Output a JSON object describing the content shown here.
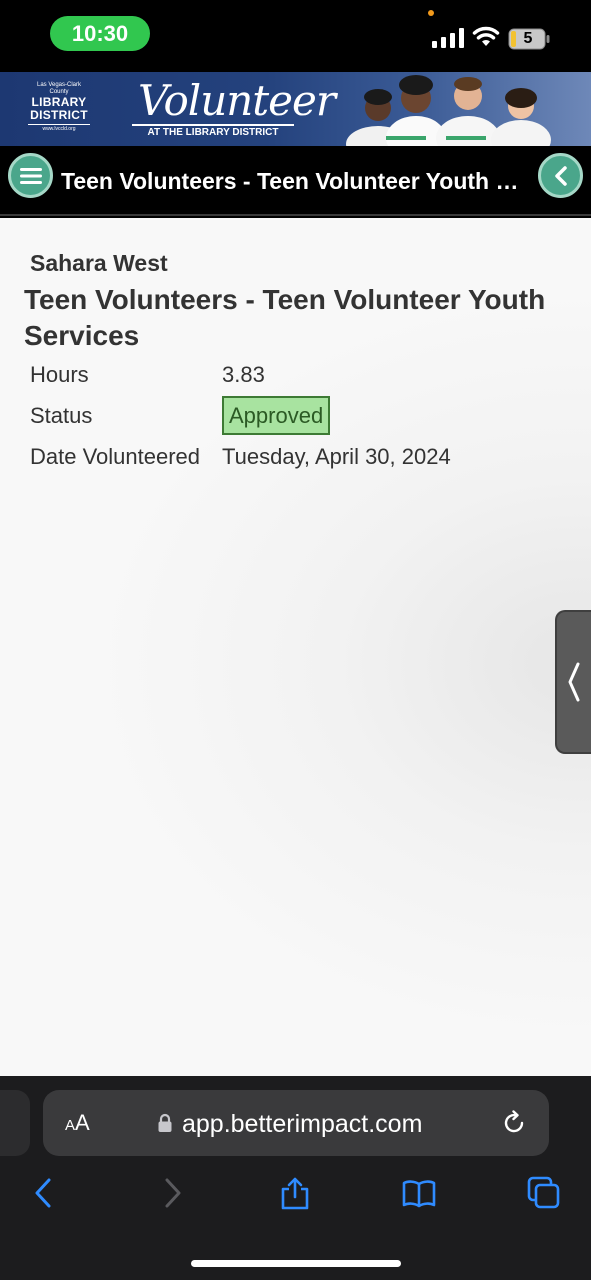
{
  "status_bar": {
    "time": "10:30",
    "battery": "5",
    "icons": [
      "signal-icon",
      "wifi-icon",
      "battery-icon"
    ]
  },
  "banner": {
    "logo_small": "Las Vegas-Clark County",
    "logo_line1": "LIBRARY",
    "logo_line2": "DISTRICT",
    "logo_url": "www.lvccld.org",
    "volunteer_word": "Volunteer",
    "volunteer_sub": "AT THE LIBRARY DISTRICT"
  },
  "navbar": {
    "title": "Teen Volunteers - Teen Volunteer Youth Services",
    "menu_icon": "hamburger-icon",
    "back_icon": "chevron-left-icon"
  },
  "record": {
    "branch": "Sahara West",
    "opportunity": "Teen Volunteers - Teen Volunteer Youth Services",
    "hours_label": "Hours",
    "hours_value": "3.83",
    "status_label": "Status",
    "status_value": "Approved",
    "date_label": "Date Volunteered",
    "date_value": "Tuesday, April 30, 2024"
  },
  "browser": {
    "aa_label_big": "A",
    "aa_label_small": "A",
    "url": "app.betterimpact.com",
    "toolbar_icons": [
      "back-icon",
      "forward-icon",
      "share-icon",
      "bookmarks-icon",
      "tabs-icon"
    ]
  },
  "colors": {
    "accent_green": "#4aa68b",
    "status_green_bg": "#a8e3a0",
    "banner_blue": "#1d3872"
  }
}
